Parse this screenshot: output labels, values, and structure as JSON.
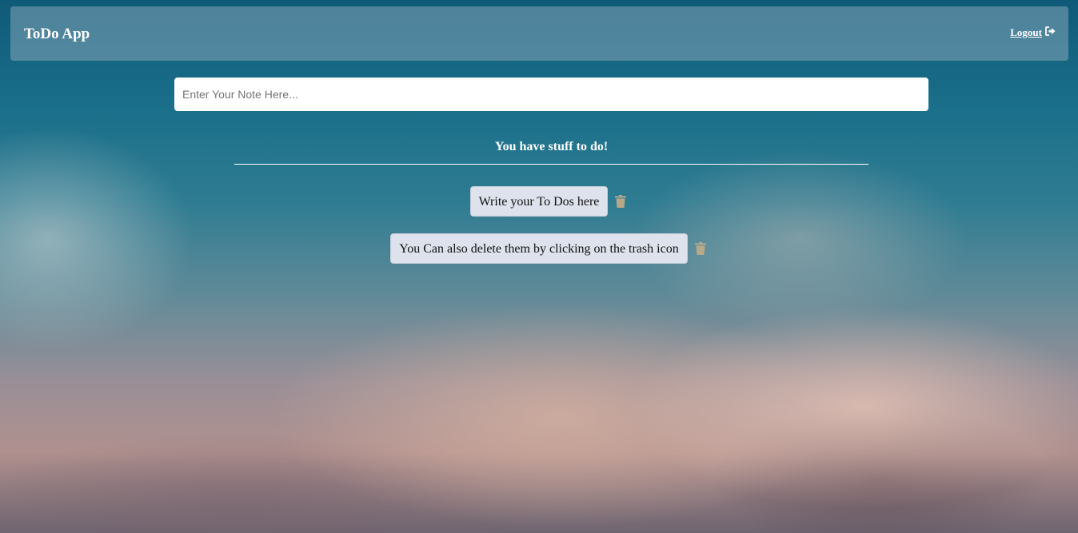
{
  "navbar": {
    "brand": "ToDo App",
    "logout_label": "Logout",
    "logout_icon": "sign-out-icon"
  },
  "input": {
    "placeholder": "Enter Your Note Here...",
    "value": ""
  },
  "status_text": "You have stuff to do!",
  "todos": [
    {
      "text": "Write your To Dos here",
      "delete_icon": "trash-icon"
    },
    {
      "text": "You Can also delete them by clicking on the trash icon",
      "delete_icon": "trash-icon"
    }
  ],
  "colors": {
    "trash_icon": "#b8a88a",
    "todo_background": "#dde2ec",
    "text_on_background": "#ffffff"
  }
}
